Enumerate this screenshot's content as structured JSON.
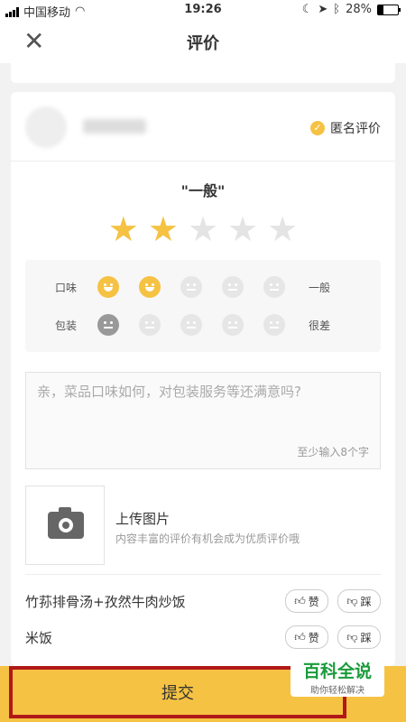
{
  "status_bar": {
    "carrier": "中国移动",
    "time": "19:26",
    "battery": "28%",
    "battery_level": 0.28
  },
  "nav": {
    "close_icon": "✕",
    "title": "评价"
  },
  "review": {
    "anonymous_label": "匿名评价",
    "rating_word": "\"一般\"",
    "stars_total": 5,
    "stars_selected": 2,
    "subratings": [
      {
        "label": "口味",
        "value_label": "一般",
        "selected": 2
      },
      {
        "label": "包装",
        "value_label": "很差",
        "selected": 1
      }
    ],
    "comment_placeholder": "亲，菜品口味如何，对包装服务等还满意吗?",
    "comment_hint": "至少输入8个字",
    "upload_title": "上传图片",
    "upload_subtitle": "内容丰富的评价有机会成为优质评价哦",
    "items": [
      {
        "name": "竹荪排骨汤+孜然牛肉炒饭",
        "like": "赞",
        "dislike": "踩"
      },
      {
        "name": "米饭",
        "like": "赞",
        "dislike": "踩"
      }
    ]
  },
  "submit_label": "提交",
  "watermark": {
    "title": "百科全说",
    "subtitle": "助你轻松解决"
  }
}
